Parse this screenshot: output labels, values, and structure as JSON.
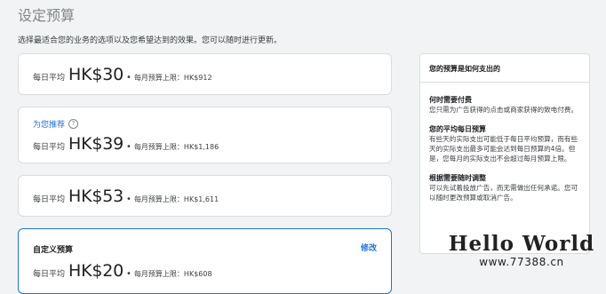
{
  "header": {
    "title": "设定预算",
    "subtitle": "选择最适合您的业务的选项以及您希望达到的效果。您可以随时进行更新。"
  },
  "options": [
    {
      "daily_label": "每日平均",
      "amount": "HK$30",
      "separator": "•",
      "monthly_label": "每月预算上限：HK$912"
    },
    {
      "recommend_label": "为您推荐",
      "daily_label": "每日平均",
      "amount": "HK$39",
      "separator": "•",
      "monthly_label": "每月预算上限：HK$1,186"
    },
    {
      "daily_label": "每日平均",
      "amount": "HK$53",
      "separator": "•",
      "monthly_label": "每月预算上限：HK$1,611"
    },
    {
      "custom_label": "自定义预算",
      "edit_label": "修改",
      "daily_label": "每日平均",
      "amount": "HK$20",
      "separator": "•",
      "monthly_label": "每月预算上限：HK$608"
    }
  ],
  "help_icon": "question-circle-icon",
  "sidebar": {
    "title": "您的预算是如何支出的",
    "sections": [
      {
        "title": "何时需要付费",
        "text": "您只需为广告获得的点击或商家获得的致电付费。"
      },
      {
        "title": "您的平均每日预算",
        "text": "有些天的实际支出可能低于每日平均预算，而有些天的实际支出最多可能会达到每日预算的4倍。但是，您每月的实际支出不会超过每月预算上限。"
      },
      {
        "title": "根据需要随时调整",
        "text": "可以先试着投放广告，而无需做出任何承诺。您可以随时更改预算或取消广告。"
      }
    ]
  },
  "watermark": {
    "line1": "Hello World",
    "line2": "www.77388.cn"
  },
  "colors": {
    "accent": "#1a73e8",
    "background": "#f1f3f4"
  }
}
